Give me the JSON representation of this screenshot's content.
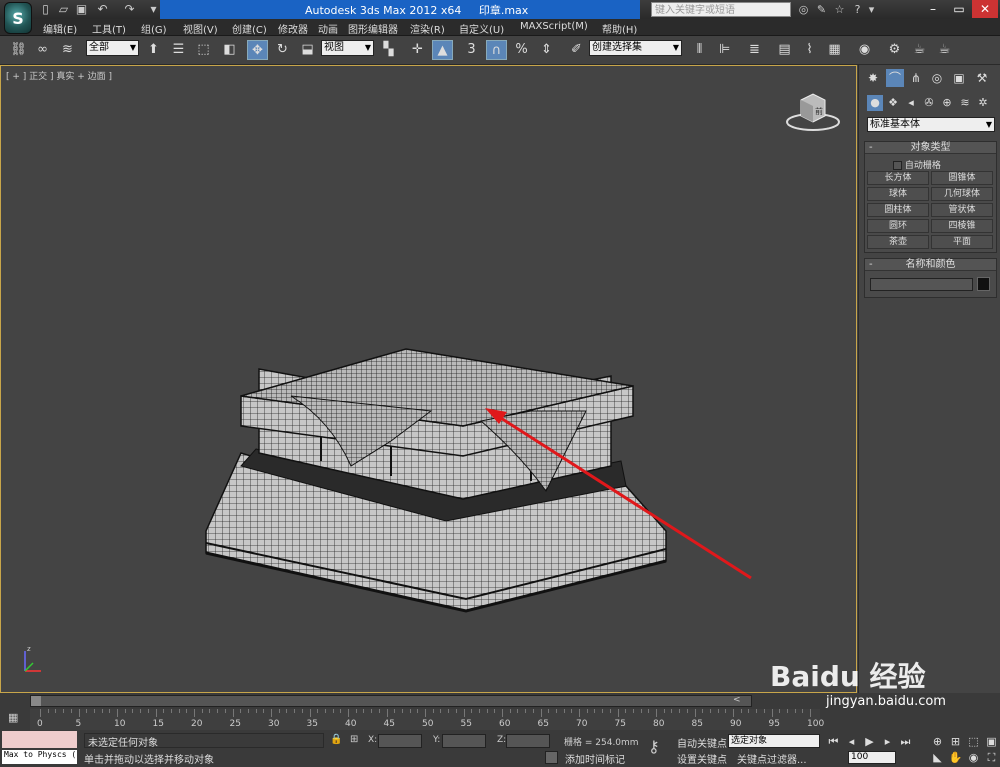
{
  "title": {
    "app_name": "Autodesk 3ds Max  2012 x64",
    "file_name": "印章.max",
    "search_placeholder": "键入关键字或短语"
  },
  "menu": [
    "编辑(E)",
    "工具(T)",
    "组(G)",
    "视图(V)",
    "创建(C)",
    "修改器",
    "动画",
    "图形编辑器",
    "渲染(R)",
    "自定义(U)",
    "MAXScript(M)",
    "帮助(H)"
  ],
  "toolbar": {
    "selection_filter": "全部",
    "ref_coord": "视图",
    "named_selection": "创建选择集",
    "snap_label": "3"
  },
  "viewport": {
    "label": "[ + ] 正交 ] 真实 + 边面 ]",
    "viewcube_label": "前"
  },
  "command_panel": {
    "category": "标准基本体",
    "rollout_object_type": "对象类型",
    "autogrid": "自动栅格",
    "object_buttons": [
      "长方体",
      "圆锥体",
      "球体",
      "几何球体",
      "圆柱体",
      "管状体",
      "圆环",
      "四棱锥",
      "茶壶",
      "平面"
    ],
    "rollout_name_color": "名称和颜色",
    "object_color": "#111111"
  },
  "timeline": {
    "ticks": [
      "0",
      "5",
      "10",
      "15",
      "20",
      "25",
      "30",
      "35",
      "40",
      "45",
      "50",
      "55",
      "60",
      "65",
      "70",
      "75",
      "80",
      "85",
      "90",
      "95",
      "100"
    ]
  },
  "status": {
    "maxscript_text": "Max to Physcs (",
    "selection_status": "未选定任何对象",
    "prompt": "单击并拖动以选择并移动对象",
    "x_label": "X:",
    "y_label": "Y:",
    "z_label": "Z:",
    "grid": "栅格 = 254.0mm",
    "add_time_tag": "添加时间标记",
    "auto_key": "自动关键点",
    "set_key": "设置关键点",
    "selected_set": "选定对象",
    "key_filters": "关键点过滤器...",
    "current_frame": "100"
  },
  "watermark": {
    "brand": "Baidu 经验",
    "url": "jingyan.baidu.com"
  },
  "colors": {
    "title_bar": "#1a63c4",
    "viewport_border": "#c8a64a",
    "arrow": "#e0181b"
  }
}
